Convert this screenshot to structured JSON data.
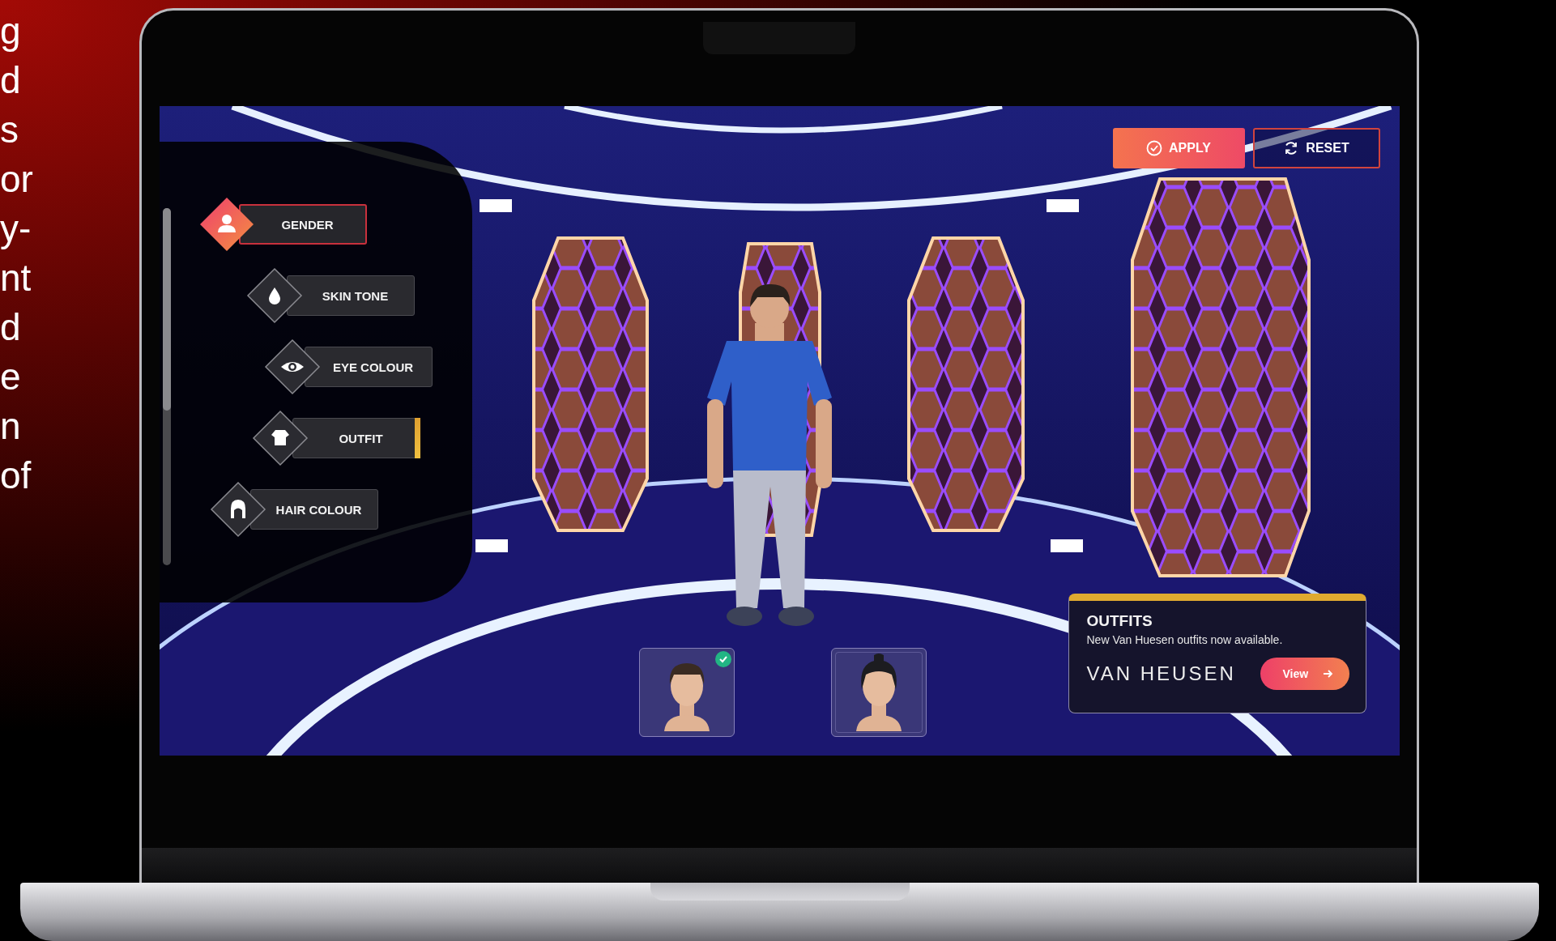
{
  "slide_text": [
    "g",
    "d",
    "s",
    "or",
    "y-",
    "nt",
    "d",
    "e",
    "n",
    "of"
  ],
  "menu": {
    "items": [
      {
        "label": "GENDER",
        "selected": true,
        "flagged": false
      },
      {
        "label": "SKIN TONE",
        "selected": false,
        "flagged": false
      },
      {
        "label": "EYE COLOUR",
        "selected": false,
        "flagged": false
      },
      {
        "label": "OUTFIT",
        "selected": false,
        "flagged": true
      },
      {
        "label": "HAIR COLOUR",
        "selected": false,
        "flagged": false
      }
    ]
  },
  "actions": [
    {
      "label": "APPLY",
      "kind": "primary"
    },
    {
      "label": "RESET",
      "kind": "outline"
    }
  ],
  "avatars": [
    {
      "selected": true
    },
    {
      "selected": false
    }
  ],
  "promo": {
    "title": "OUTFITS",
    "message": "New Van Huesen outfits now available.",
    "brand": "VAN HEUSEN",
    "button": "View"
  }
}
